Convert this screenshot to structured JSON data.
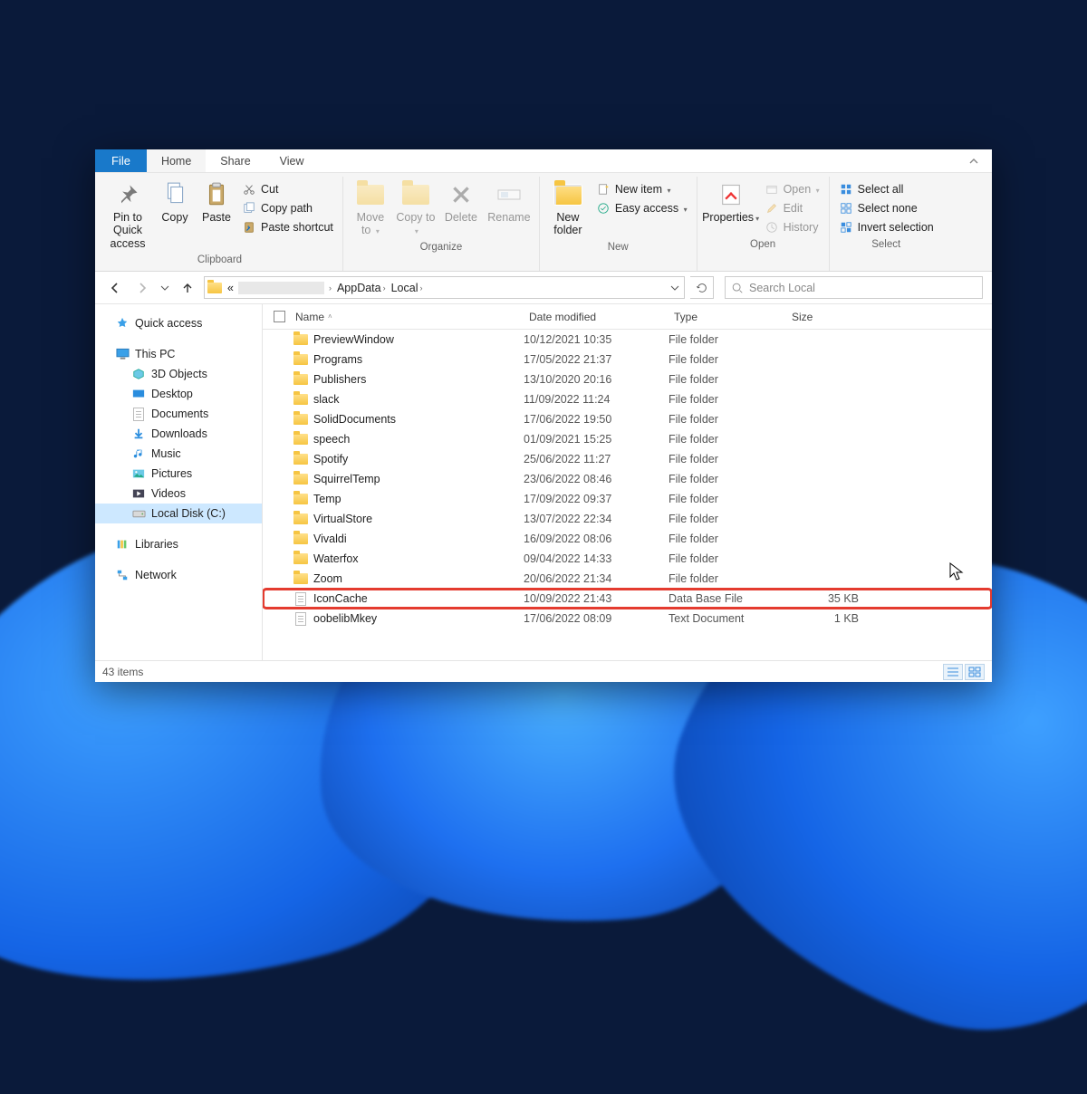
{
  "tabs": {
    "file": "File",
    "home": "Home",
    "share": "Share",
    "view": "View"
  },
  "ribbon": {
    "pin": "Pin to Quick access",
    "copy": "Copy",
    "paste": "Paste",
    "cut": "Cut",
    "copy_path": "Copy path",
    "paste_shortcut": "Paste shortcut",
    "clipboard": "Clipboard",
    "move_to": "Move to",
    "copy_to": "Copy to",
    "delete": "Delete",
    "rename": "Rename",
    "organize": "Organize",
    "new_folder": "New folder",
    "new_item": "New item",
    "easy_access": "Easy access",
    "new": "New",
    "properties": "Properties",
    "open": "Open",
    "edit": "Edit",
    "history": "History",
    "open_group": "Open",
    "select_all": "Select all",
    "select_none": "Select none",
    "invert_selection": "Invert selection",
    "select": "Select"
  },
  "breadcrumb": {
    "seg1": "AppData",
    "seg2": "Local"
  },
  "search": {
    "placeholder": "Search Local"
  },
  "sidebar": {
    "quick_access": "Quick access",
    "this_pc": "This PC",
    "objects3d": "3D Objects",
    "desktop": "Desktop",
    "documents": "Documents",
    "downloads": "Downloads",
    "music": "Music",
    "pictures": "Pictures",
    "videos": "Videos",
    "local_disk": "Local Disk (C:)",
    "libraries": "Libraries",
    "network": "Network"
  },
  "columns": {
    "name": "Name",
    "date": "Date modified",
    "type": "Type",
    "size": "Size"
  },
  "files": [
    {
      "name": "PreviewWindow",
      "date": "10/12/2021 10:35",
      "type": "File folder",
      "size": "",
      "kind": "folder"
    },
    {
      "name": "Programs",
      "date": "17/05/2022 21:37",
      "type": "File folder",
      "size": "",
      "kind": "folder"
    },
    {
      "name": "Publishers",
      "date": "13/10/2020 20:16",
      "type": "File folder",
      "size": "",
      "kind": "folder"
    },
    {
      "name": "slack",
      "date": "11/09/2022 11:24",
      "type": "File folder",
      "size": "",
      "kind": "folder"
    },
    {
      "name": "SolidDocuments",
      "date": "17/06/2022 19:50",
      "type": "File folder",
      "size": "",
      "kind": "folder"
    },
    {
      "name": "speech",
      "date": "01/09/2021 15:25",
      "type": "File folder",
      "size": "",
      "kind": "folder"
    },
    {
      "name": "Spotify",
      "date": "25/06/2022 11:27",
      "type": "File folder",
      "size": "",
      "kind": "folder"
    },
    {
      "name": "SquirrelTemp",
      "date": "23/06/2022 08:46",
      "type": "File folder",
      "size": "",
      "kind": "folder"
    },
    {
      "name": "Temp",
      "date": "17/09/2022 09:37",
      "type": "File folder",
      "size": "",
      "kind": "folder"
    },
    {
      "name": "VirtualStore",
      "date": "13/07/2022 22:34",
      "type": "File folder",
      "size": "",
      "kind": "folder"
    },
    {
      "name": "Vivaldi",
      "date": "16/09/2022 08:06",
      "type": "File folder",
      "size": "",
      "kind": "folder"
    },
    {
      "name": "Waterfox",
      "date": "09/04/2022 14:33",
      "type": "File folder",
      "size": "",
      "kind": "folder"
    },
    {
      "name": "Zoom",
      "date": "20/06/2022 21:34",
      "type": "File folder",
      "size": "",
      "kind": "folder"
    },
    {
      "name": "IconCache",
      "date": "10/09/2022 21:43",
      "type": "Data Base File",
      "size": "35 KB",
      "kind": "file",
      "highlight": true
    },
    {
      "name": "oobelibMkey",
      "date": "17/06/2022 08:09",
      "type": "Text Document",
      "size": "1 KB",
      "kind": "file"
    }
  ],
  "status": {
    "items": "43 items"
  }
}
